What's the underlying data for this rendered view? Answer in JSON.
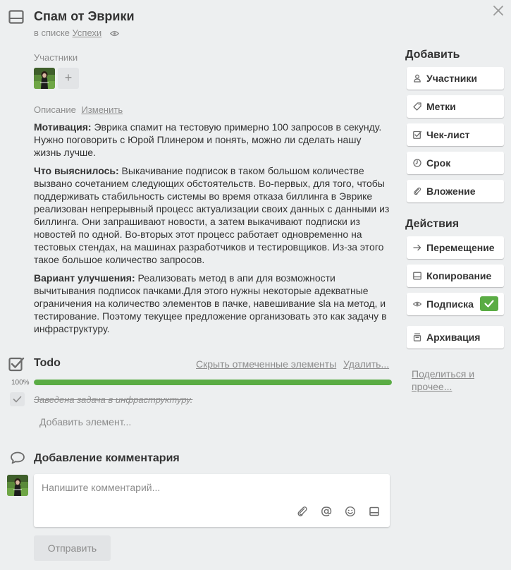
{
  "card": {
    "title": "Спам от Эврики",
    "list_prefix": "в списке",
    "list_name": "Успехи"
  },
  "members": {
    "label": "Участники",
    "add_symbol": "+"
  },
  "description": {
    "label": "Описание",
    "edit_label": "Изменить",
    "paragraphs": [
      {
        "bold": "Мотивация:",
        "text": " Эврика спамит на тестовую примерно 100 запросов в секунду. Нужно поговорить с Юрой Плинером и понять, можно ли сделать нашу жизнь лучше."
      },
      {
        "bold": "Что выяснилось:",
        "text": " Выкачивание подписок в таком большом количестве вызвано сочетанием следующих обстоятельств. Во-первых, для того, чтобы поддерживать стабильность системы во время отказа биллинга в Эврике реализован непрерывный процесс актуализации своих данных с данными из биллинга. Они запрашивают новости, а затем выкачивают подписки из новостей по одной. Во-вторых этот процесс работает одновременно на тестовых стендах, на машинах разработчиков и тестировщиков. Из-за этого такое большое количество запросов."
      },
      {
        "bold": "Вариант улучшения:",
        "text": " Реализовать метод в апи для возможности вычитывания подписок пачками.Для этого нужны некоторые адекватные ограничения на количество элементов в пачке, навешивание sla на метод, и тестирование. Поэтому текущее предложение организовать это как задачу в инфраструктуру."
      }
    ]
  },
  "checklist": {
    "title": "Todo",
    "hide_checked_label": "Скрыть отмеченные элементы",
    "delete_label": "Удалить...",
    "percent_label": "100%",
    "progress": 1.0,
    "items": [
      {
        "text": "Заведена задача в инфраструктуру.",
        "checked": true
      }
    ],
    "add_item_label": "Добавить элемент..."
  },
  "comment": {
    "title": "Добавление комментария",
    "placeholder": "Напишите комментарий...",
    "send_label": "Отправить",
    "tools": [
      "paperclip-icon",
      "mention-icon",
      "emoji-icon",
      "card-icon"
    ]
  },
  "sidebar": {
    "add_heading": "Добавить",
    "add_buttons": [
      {
        "label": "Участники",
        "icon": "person-icon"
      },
      {
        "label": "Метки",
        "icon": "label-icon"
      },
      {
        "label": "Чек-лист",
        "icon": "checklist-icon"
      },
      {
        "label": "Срок",
        "icon": "clock-icon"
      },
      {
        "label": "Вложение",
        "icon": "paperclip-icon"
      }
    ],
    "actions_heading": "Действия",
    "action_buttons": [
      {
        "label": "Перемещение",
        "icon": "arrow-right-icon"
      },
      {
        "label": "Копирование",
        "icon": "card-icon"
      },
      {
        "label": "Подписка",
        "icon": "eye-icon",
        "subscribed": true
      },
      {
        "label": "Архивация",
        "icon": "archive-icon"
      }
    ],
    "share_label": "Поделиться и прочее..."
  },
  "colors": {
    "background": "#edeff0",
    "progress_green": "#5aac44",
    "muted_text": "#8c8c8c"
  }
}
